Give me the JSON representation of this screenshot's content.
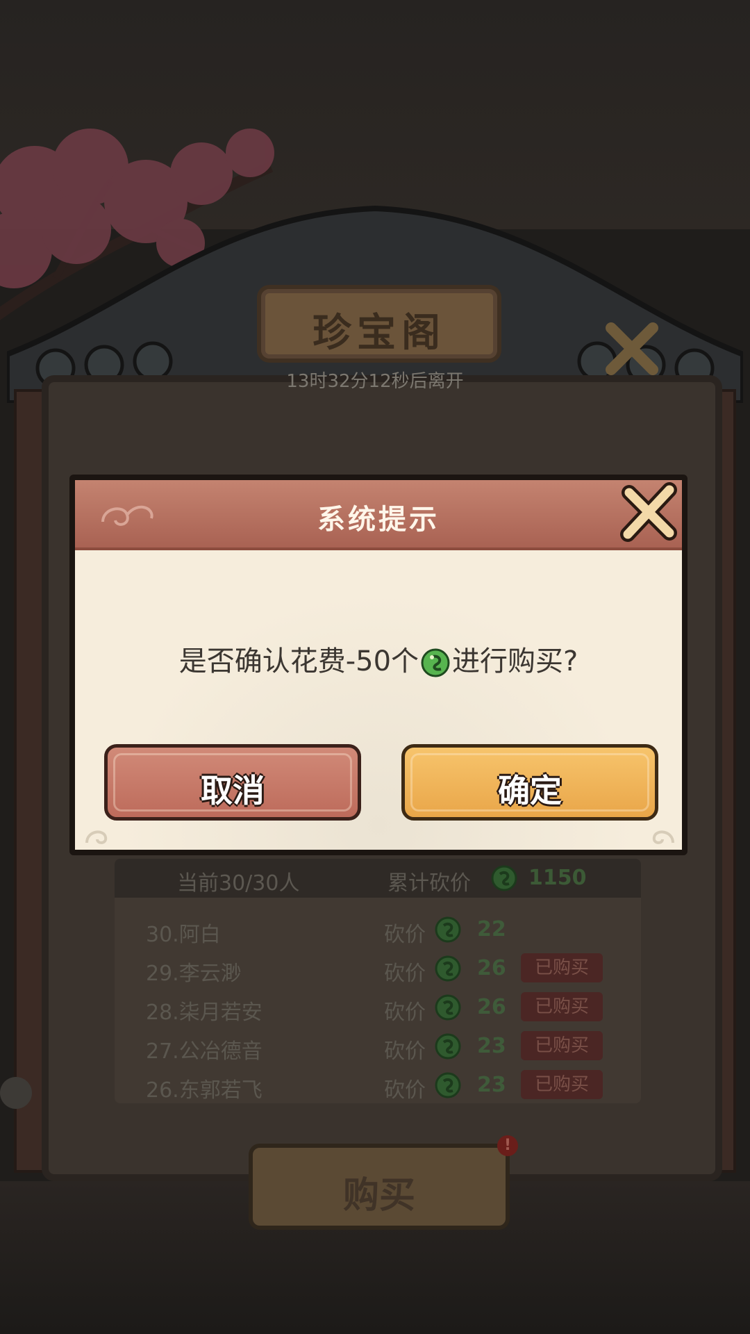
{
  "background": {
    "plaque_title": "珍宝阁",
    "timer": "13时32分12秒后离开",
    "list_header": {
      "count": "当前30/30人",
      "total_label": "累计砍价",
      "total_value": "1150"
    },
    "rows": [
      {
        "name": "30.阿白",
        "cut_label": "砍价",
        "value": "22",
        "badge": ""
      },
      {
        "name": "29.李云渺",
        "cut_label": "砍价",
        "value": "26",
        "badge": "已购买"
      },
      {
        "name": "28.柒月若安",
        "cut_label": "砍价",
        "value": "26",
        "badge": "已购买"
      },
      {
        "name": "27.公冶德音",
        "cut_label": "砍价",
        "value": "23",
        "badge": "已购买"
      },
      {
        "name": "26.东郭若飞",
        "cut_label": "砍价",
        "value": "23",
        "badge": "已购买"
      }
    ],
    "buy_button": "购买",
    "buy_alert": "!"
  },
  "dialog": {
    "title": "系统提示",
    "message_before": "是否确认花费-50个",
    "message_after": "进行购买?",
    "cancel_label": "取消",
    "confirm_label": "确定",
    "currency_icon": "green-jade-coin-icon"
  },
  "colors": {
    "header": "#b06d5c",
    "cancel": "#c97a68",
    "confirm": "#f0b45a",
    "dialog_bg": "#f6eddc",
    "coin": "#3fa046"
  }
}
